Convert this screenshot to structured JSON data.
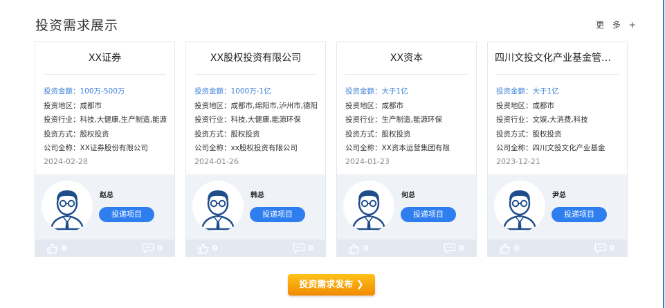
{
  "section": {
    "title": "投资需求展示",
    "more_label": "更 多 +"
  },
  "labels": {
    "amount": "投资金额：",
    "region": "投资地区：",
    "industry": "投资行业：",
    "method": "投资方式：",
    "company": "公司全称："
  },
  "cards": [
    {
      "name": "XX证券",
      "amount": "100万-500万",
      "region": "成都市",
      "industry": "科技,大健康,生产制造,能源",
      "method": "股权投资",
      "company": "XX证券股份有限公司",
      "date": "2024-02-28",
      "contact": "赵总",
      "button": "投递项目",
      "likes": "0",
      "comments": "0"
    },
    {
      "name": "XX股权投资有限公司",
      "amount": "1000万-1亿",
      "region": "成都市,绵阳市,泸州市,德阳",
      "industry": "科技,大健康,能源环保",
      "method": "股权投资",
      "company": "xx股权投资有限公司",
      "date": "2024-01-26",
      "contact": "韩总",
      "button": "投递项目",
      "likes": "0",
      "comments": "0"
    },
    {
      "name": "XX资本",
      "amount": "大于1亿",
      "region": "成都市",
      "industry": "生产制造,能源环保",
      "method": "股权投资",
      "company": "XX资本运营集团有限",
      "date": "2024-01-23",
      "contact": "何总",
      "button": "投递项目",
      "likes": "0",
      "comments": "0"
    },
    {
      "name": "四川文投文化产业基金管理...",
      "amount": "大于1亿",
      "region": "成都市",
      "industry": "文娱,大消费,科技",
      "method": "股权投资",
      "company": "四川文投文化产业基金",
      "date": "2023-12-21",
      "contact": "尹总",
      "button": "投递项目",
      "likes": "0",
      "comments": "0"
    }
  ],
  "publish_button": "投资需求发布 ❯",
  "colors": {
    "accent_blue": "#2f7ef0",
    "amount_blue": "#3a7fd9",
    "publish_orange": "#f59a00",
    "contact_bg": "#eff3f8",
    "stats_bg": "#e3e8f1"
  }
}
